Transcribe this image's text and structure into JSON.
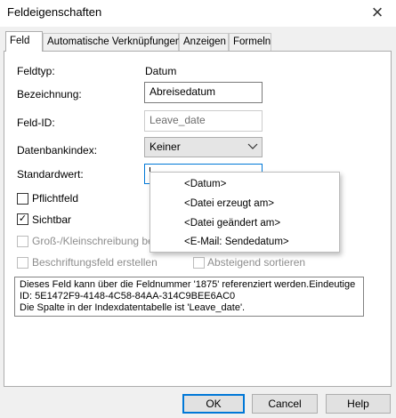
{
  "window": {
    "title": "Feldeigenschaften",
    "close_glyph": "×"
  },
  "tabs": [
    "Feld",
    "Automatische Verknüpfungen",
    "Anzeigen",
    "Formeln"
  ],
  "form": {
    "feldtyp_label": "Feldtyp:",
    "feldtyp_value": "Datum",
    "bezeichnung_label": "Bezeichnung:",
    "bezeichnung_value": "Abreisedatum",
    "feldid_label": "Feld-ID:",
    "feldid_value": "Leave_date",
    "dbindex_label": "Datenbankindex:",
    "dbindex_value": "Keiner",
    "standardwert_label": "Standardwert:",
    "standardwert_value": "",
    "pflichtfeld_label": "Pflichtfeld",
    "pflichtfeld_checked": false,
    "sichtbar_label": "Sichtbar",
    "sichtbar_checked": true,
    "gross_klein_label": "Groß-/Kleinschreibung beach",
    "beschriftung_label": "Beschriftungsfeld erstellen",
    "absteigend_label": "Absteigend sortieren",
    "check_glyph": "✓"
  },
  "info": {
    "line1": "Dieses Feld kann über die Feldnummer '1875' referenziert werden.Eindeutige",
    "line2": "ID: 5E1472F9-4148-4C58-84AA-314C9BEE6AC0",
    "line3": "Die Spalte in der Indexdatentabelle ist 'Leave_date'."
  },
  "popup": {
    "items": [
      "<Datum>",
      "<Datei erzeugt am>",
      "<Datei geändert am>",
      "<E-Mail: Sendedatum>"
    ]
  },
  "buttons": {
    "ok": "OK",
    "cancel": "Cancel",
    "help": "Help"
  },
  "colors": {
    "accent": "#0078d7",
    "panel_bg": "#ffffff",
    "dialog_bg": "#f0f0f0"
  }
}
